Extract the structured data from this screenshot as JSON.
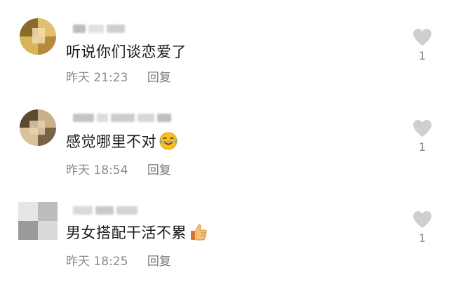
{
  "comments": [
    {
      "avatar_icon": "user-avatar-icon",
      "text": "听说你们谈恋爱了",
      "time": "昨天 21:23",
      "reply_label": "回复",
      "like_count": "1",
      "emoji": ""
    },
    {
      "avatar_icon": "user-avatar-icon",
      "text": "感觉哪里不对",
      "time": "昨天 18:54",
      "reply_label": "回复",
      "like_count": "1",
      "emoji": "laughing-tears-emoji"
    },
    {
      "avatar_icon": "user-avatar-icon",
      "text": "男女搭配干活不累",
      "time": "昨天 18:25",
      "reply_label": "回复",
      "like_count": "1",
      "emoji": "thumbs-up-emoji"
    }
  ],
  "colors": {
    "text": "#1a1a1a",
    "meta": "#8a8a8a",
    "heart": "#cfcfcf"
  }
}
